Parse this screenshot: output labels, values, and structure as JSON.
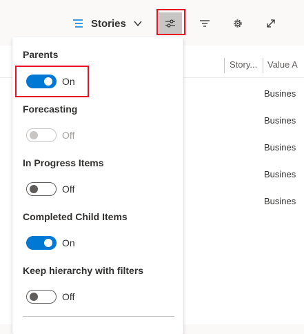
{
  "toolbar": {
    "view_label": "Stories",
    "icons": {
      "view": "list-lines-icon",
      "view_dropdown": "chevron-down-icon",
      "view_options": "sliders-icon",
      "filter": "filter-icon",
      "settings": "gear-icon",
      "fullscreen": "expand-icon"
    }
  },
  "grid": {
    "columns": [
      "Story...",
      "Value A"
    ],
    "rows": [
      "Busines",
      "Busines",
      "Busines",
      "Busines",
      "Busines"
    ]
  },
  "panel": {
    "sections": [
      {
        "label": "Parents",
        "state": "On"
      },
      {
        "label": "Forecasting",
        "state": "Off"
      },
      {
        "label": "In Progress Items",
        "state": "Off"
      },
      {
        "label": "Completed Child Items",
        "state": "On"
      },
      {
        "label": "Keep hierarchy with filters",
        "state": "Off"
      }
    ]
  },
  "colors": {
    "accent": "#0078d4",
    "highlight": "#e81123",
    "toggle_off": "#605e5c",
    "disabled": "#c8c6c4"
  }
}
